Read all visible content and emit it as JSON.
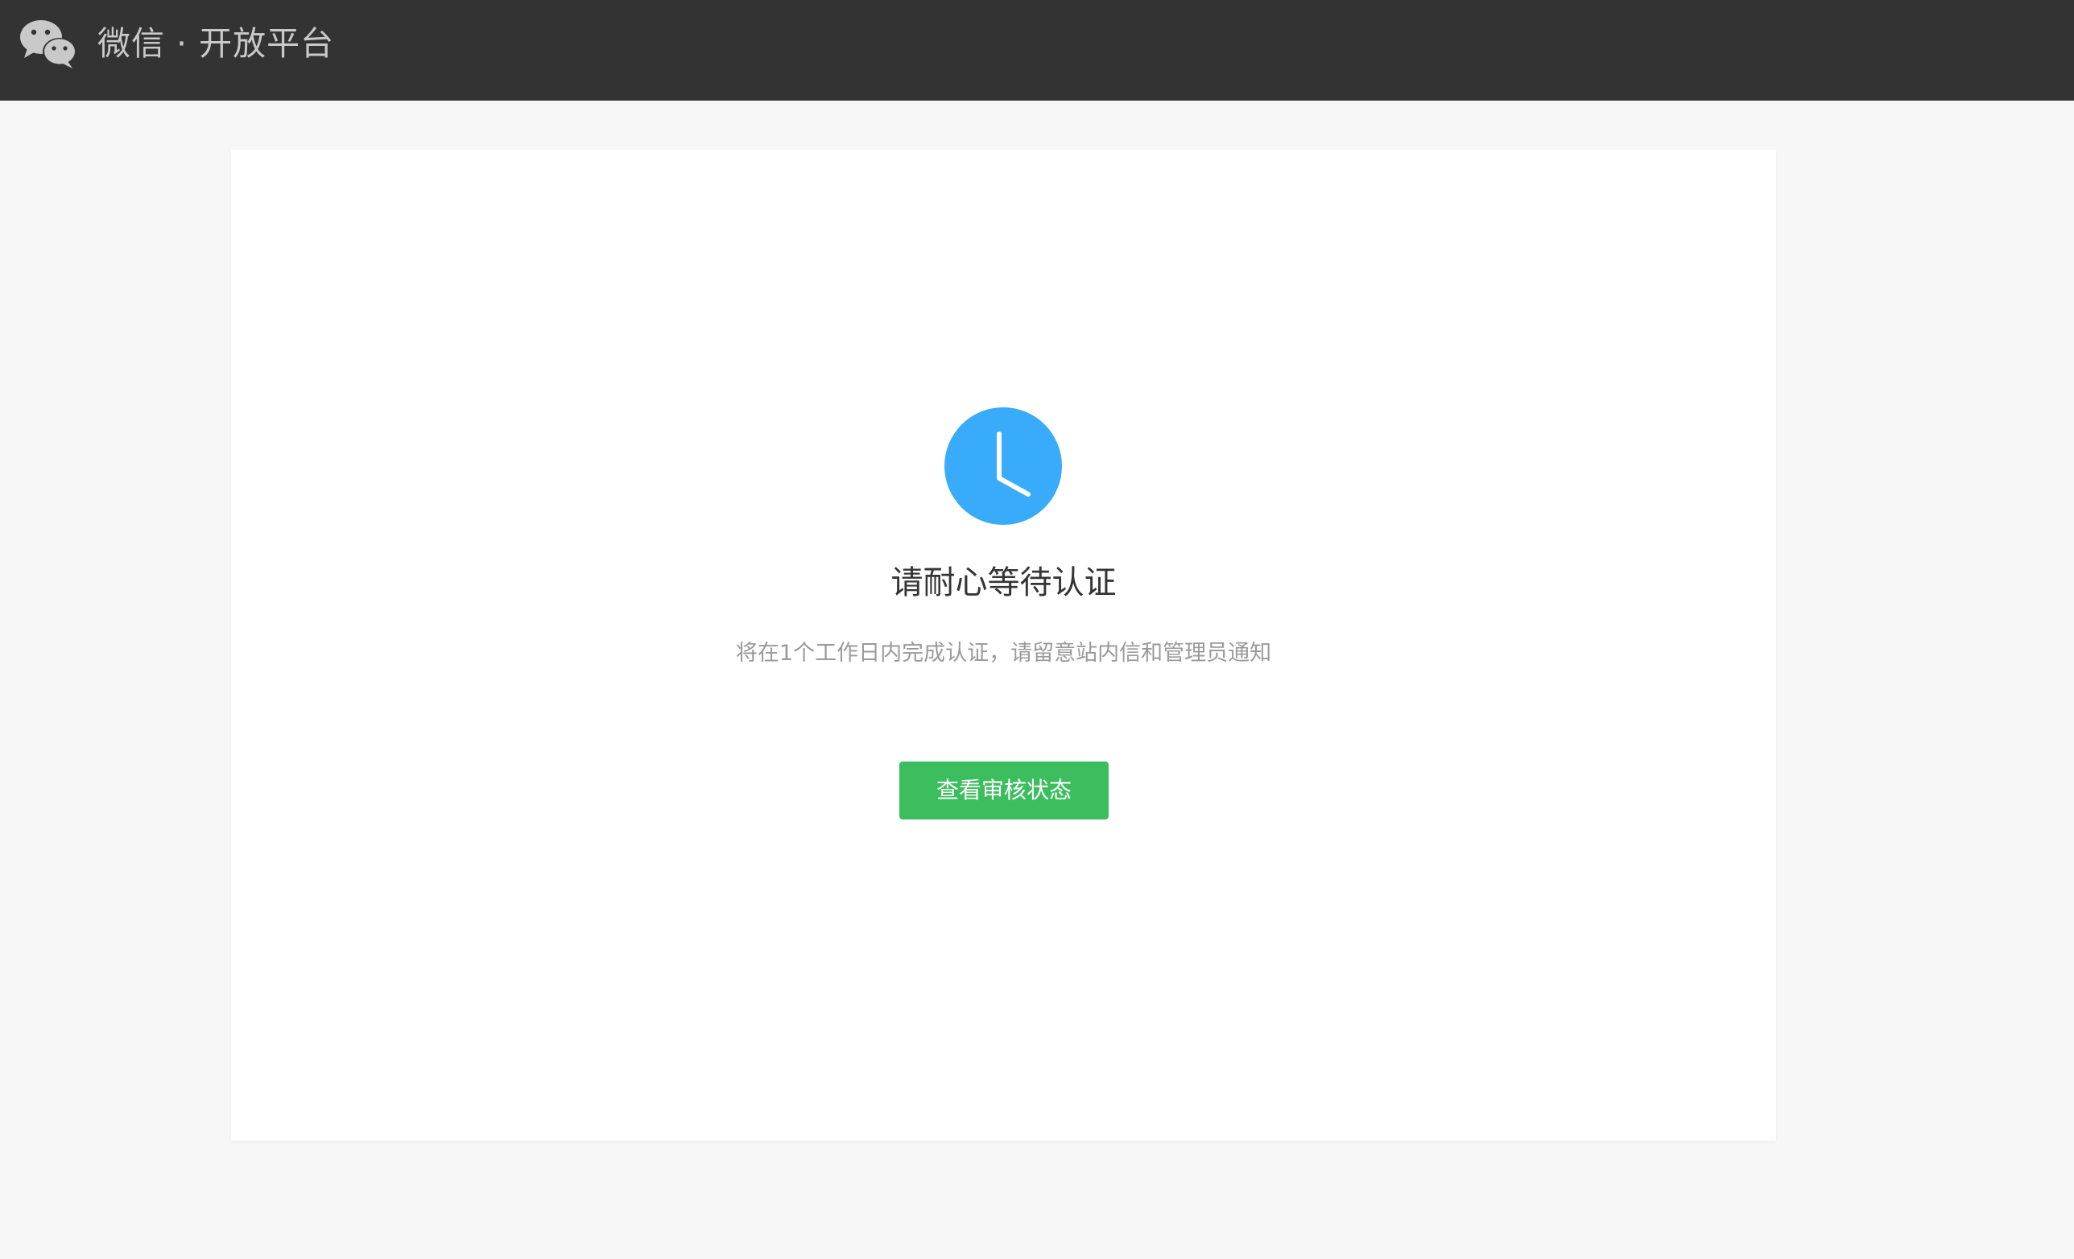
{
  "header": {
    "logo_icon": "wechat-logo-icon",
    "title": "微信 · 开放平台"
  },
  "main": {
    "status_icon": "clock-icon",
    "title": "请耐心等待认证",
    "description": "将在1个工作日内完成认证，请留意站内信和管理员通知",
    "check_button_label": "查看审核状态"
  },
  "colors": {
    "header_bg": "#333333",
    "page_bg": "#f7f7f7",
    "clock_blue": "#39abfb",
    "button_green": "#3cbe5f"
  }
}
